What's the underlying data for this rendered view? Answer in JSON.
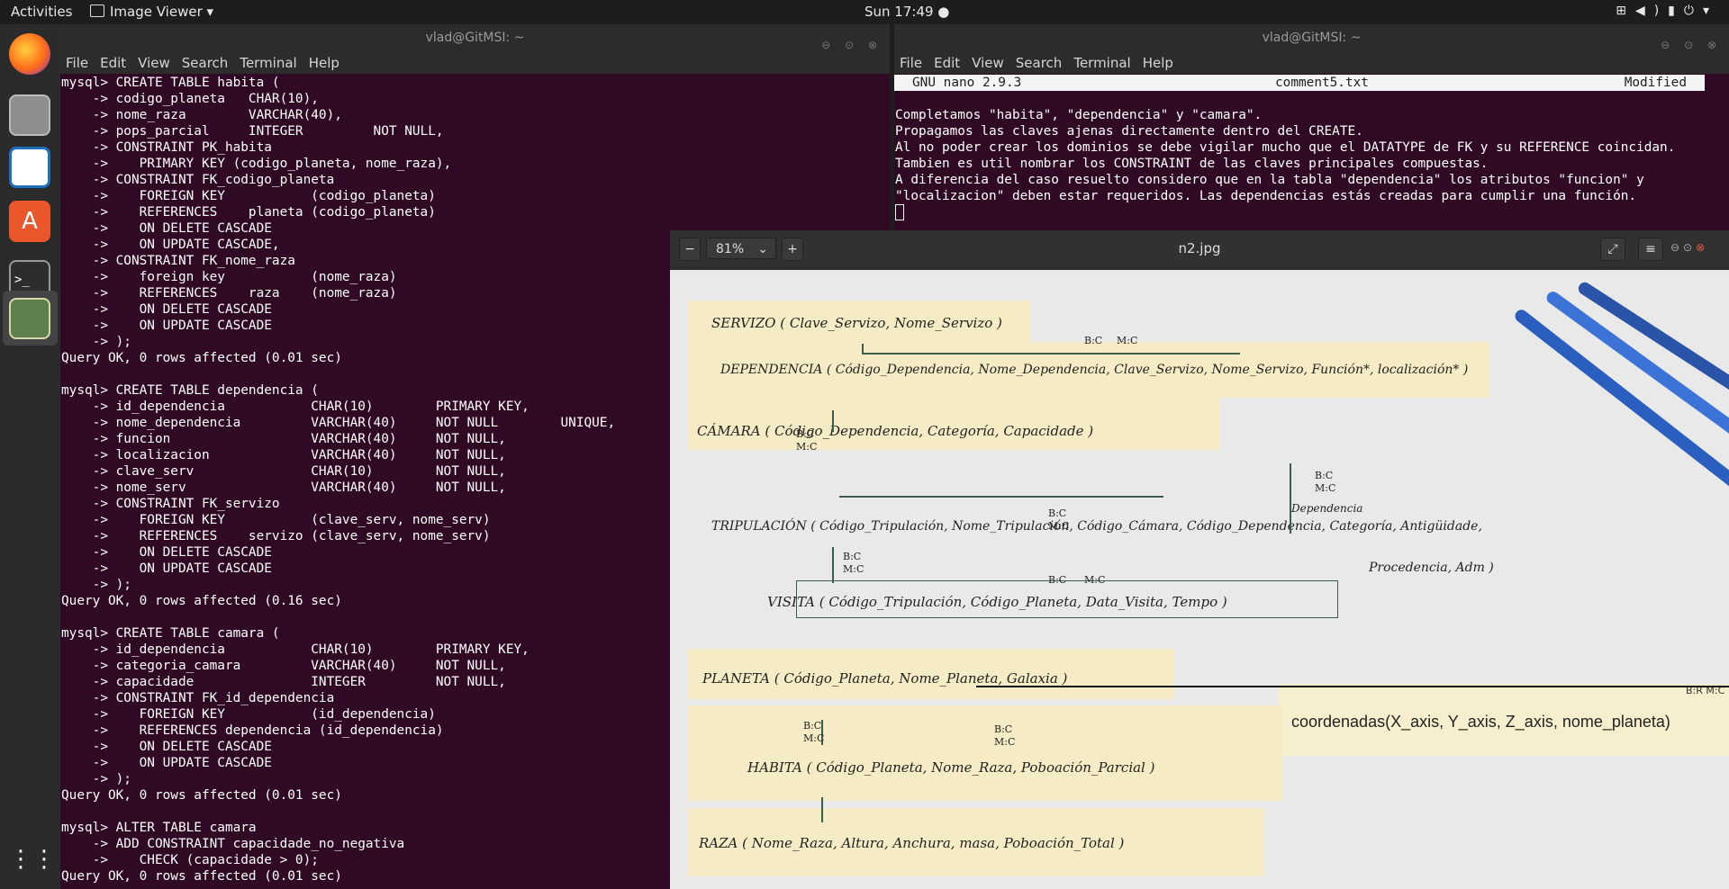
{
  "topbar": {
    "activities": "Activities",
    "app_name": "Image Viewer ▾",
    "clock": "Sun 17:49 ●",
    "tray_icons": [
      "network-icon",
      "volume-icon",
      "battery-icon",
      "power-icon"
    ]
  },
  "dock": {
    "apps": [
      "firefox-icon",
      "files-icon",
      "writer-icon",
      "software-icon",
      "terminal-icon",
      "image-viewer-icon",
      "show-apps-icon"
    ]
  },
  "terminal_left": {
    "title": "vlad@GitMSI: ~",
    "menu": [
      "File",
      "Edit",
      "View",
      "Search",
      "Terminal",
      "Help"
    ],
    "text": "mysql> CREATE TABLE habita (\n    -> codigo_planeta   CHAR(10),\n    -> nome_raza        VARCHAR(40),\n    -> pops_parcial     INTEGER         NOT NULL,\n    -> CONSTRAINT PK_habita\n    ->    PRIMARY KEY (codigo_planeta, nome_raza),\n    -> CONSTRAINT FK_codigo_planeta\n    ->    FOREIGN KEY           (codigo_planeta)\n    ->    REFERENCES    planeta (codigo_planeta)\n    ->    ON DELETE CASCADE\n    ->    ON UPDATE CASCADE,\n    -> CONSTRAINT FK_nome_raza\n    ->    foreign key           (nome_raza)\n    ->    REFERENCES    raza    (nome_raza)\n    ->    ON DELETE CASCADE\n    ->    ON UPDATE CASCADE\n    -> );\nQuery OK, 0 rows affected (0.01 sec)\n\nmysql> CREATE TABLE dependencia (\n    -> id_dependencia           CHAR(10)        PRIMARY KEY,\n    -> nome_dependencia         VARCHAR(40)     NOT NULL        UNIQUE,\n    -> funcion                  VARCHAR(40)     NOT NULL,\n    -> localizacion             VARCHAR(40)     NOT NULL,\n    -> clave_serv               CHAR(10)        NOT NULL,\n    -> nome_serv                VARCHAR(40)     NOT NULL,\n    -> CONSTRAINT FK_servizo\n    ->    FOREIGN KEY           (clave_serv, nome_serv)\n    ->    REFERENCES    servizo (clave_serv, nome_serv)\n    ->    ON DELETE CASCADE\n    ->    ON UPDATE CASCADE\n    -> );\nQuery OK, 0 rows affected (0.16 sec)\n\nmysql> CREATE TABLE camara (\n    -> id_dependencia           CHAR(10)        PRIMARY KEY,\n    -> categoria_camara         VARCHAR(40)     NOT NULL,\n    -> capacidade               INTEGER         NOT NULL,\n    -> CONSTRAINT FK_id_dependencia\n    ->    FOREIGN KEY           (id_dependencia)\n    ->    REFERENCES dependencia (id_dependencia)\n    ->    ON DELETE CASCADE\n    ->    ON UPDATE CASCADE\n    -> );\nQuery OK, 0 rows affected (0.01 sec)\n\nmysql> ALTER TABLE camara\n    -> ADD CONSTRAINT capacidade_no_negativa\n    ->    CHECK (capacidade > 0);\nQuery OK, 0 rows affected (0.01 sec)"
  },
  "terminal_right": {
    "title": "vlad@GitMSI: ~",
    "menu": [
      "File",
      "Edit",
      "View",
      "Search",
      "Terminal",
      "Help"
    ],
    "nano_version": "GNU nano 2.9.3",
    "nano_file": "comment5.txt",
    "nano_status": "Modified",
    "text": "Completamos \"habita\", \"dependencia\" y \"camara\".\nPropagamos las claves ajenas directamente dentro del CREATE.\nAl no poder crear los dominios se debe vigilar mucho que el DATATYPE de FK y su REFERENCE coincidan.\nTambien es util nombrar los CONSTRAINT de las claves principales compuestas.\nA diferencia del caso resuelto considero que en la tabla \"dependencia\" los atributos \"funcion\" y\n\"localizacion\" deben estar requeridos. Las dependencias estás creadas para cumplir una función."
  },
  "image_viewer": {
    "zoom": "81%",
    "title": "n2.jpg",
    "photo": {
      "servizo": "SERVIZO ( Clave_Servizo, Nome_Servizo )",
      "dependencia": "DEPENDENCIA ( Código_Dependencia, Nome_Dependencia, Clave_Servizo, Nome_Servizo, Función*, localización* )",
      "camara": "CÁMARA ( Código_Dependencia, Categoría, Capacidade )",
      "tripulacion": "TRIPULACIÓN ( Código_Tripulación, Nome_Tripulación, Código_Cámara, Código_Dependencia, Categoría, Antigüidade,",
      "tripulacion_cont": "Procedencia, Adm )",
      "dependencia_note": "Dependencia",
      "visita": "VISITA ( Código_Tripulación, Código_Planeta, Data_Visita, Tempo )",
      "planeta": "PLANETA ( Código_Planeta, Nome_Planeta, Galaxia )",
      "coordenadas": "coordenadas(X_axis, Y_axis, Z_axis, nome_planeta)",
      "coord_note": "B:R   M:C",
      "habita": "HABITA ( Código_Planeta, Nome_Raza, Poboación_Parcial )",
      "raza": "RAZA ( Nome_Raza, Altura, Anchura, masa, Poboación_Total )",
      "rule_bc": "B:C",
      "rule_mc": "M:C"
    }
  }
}
